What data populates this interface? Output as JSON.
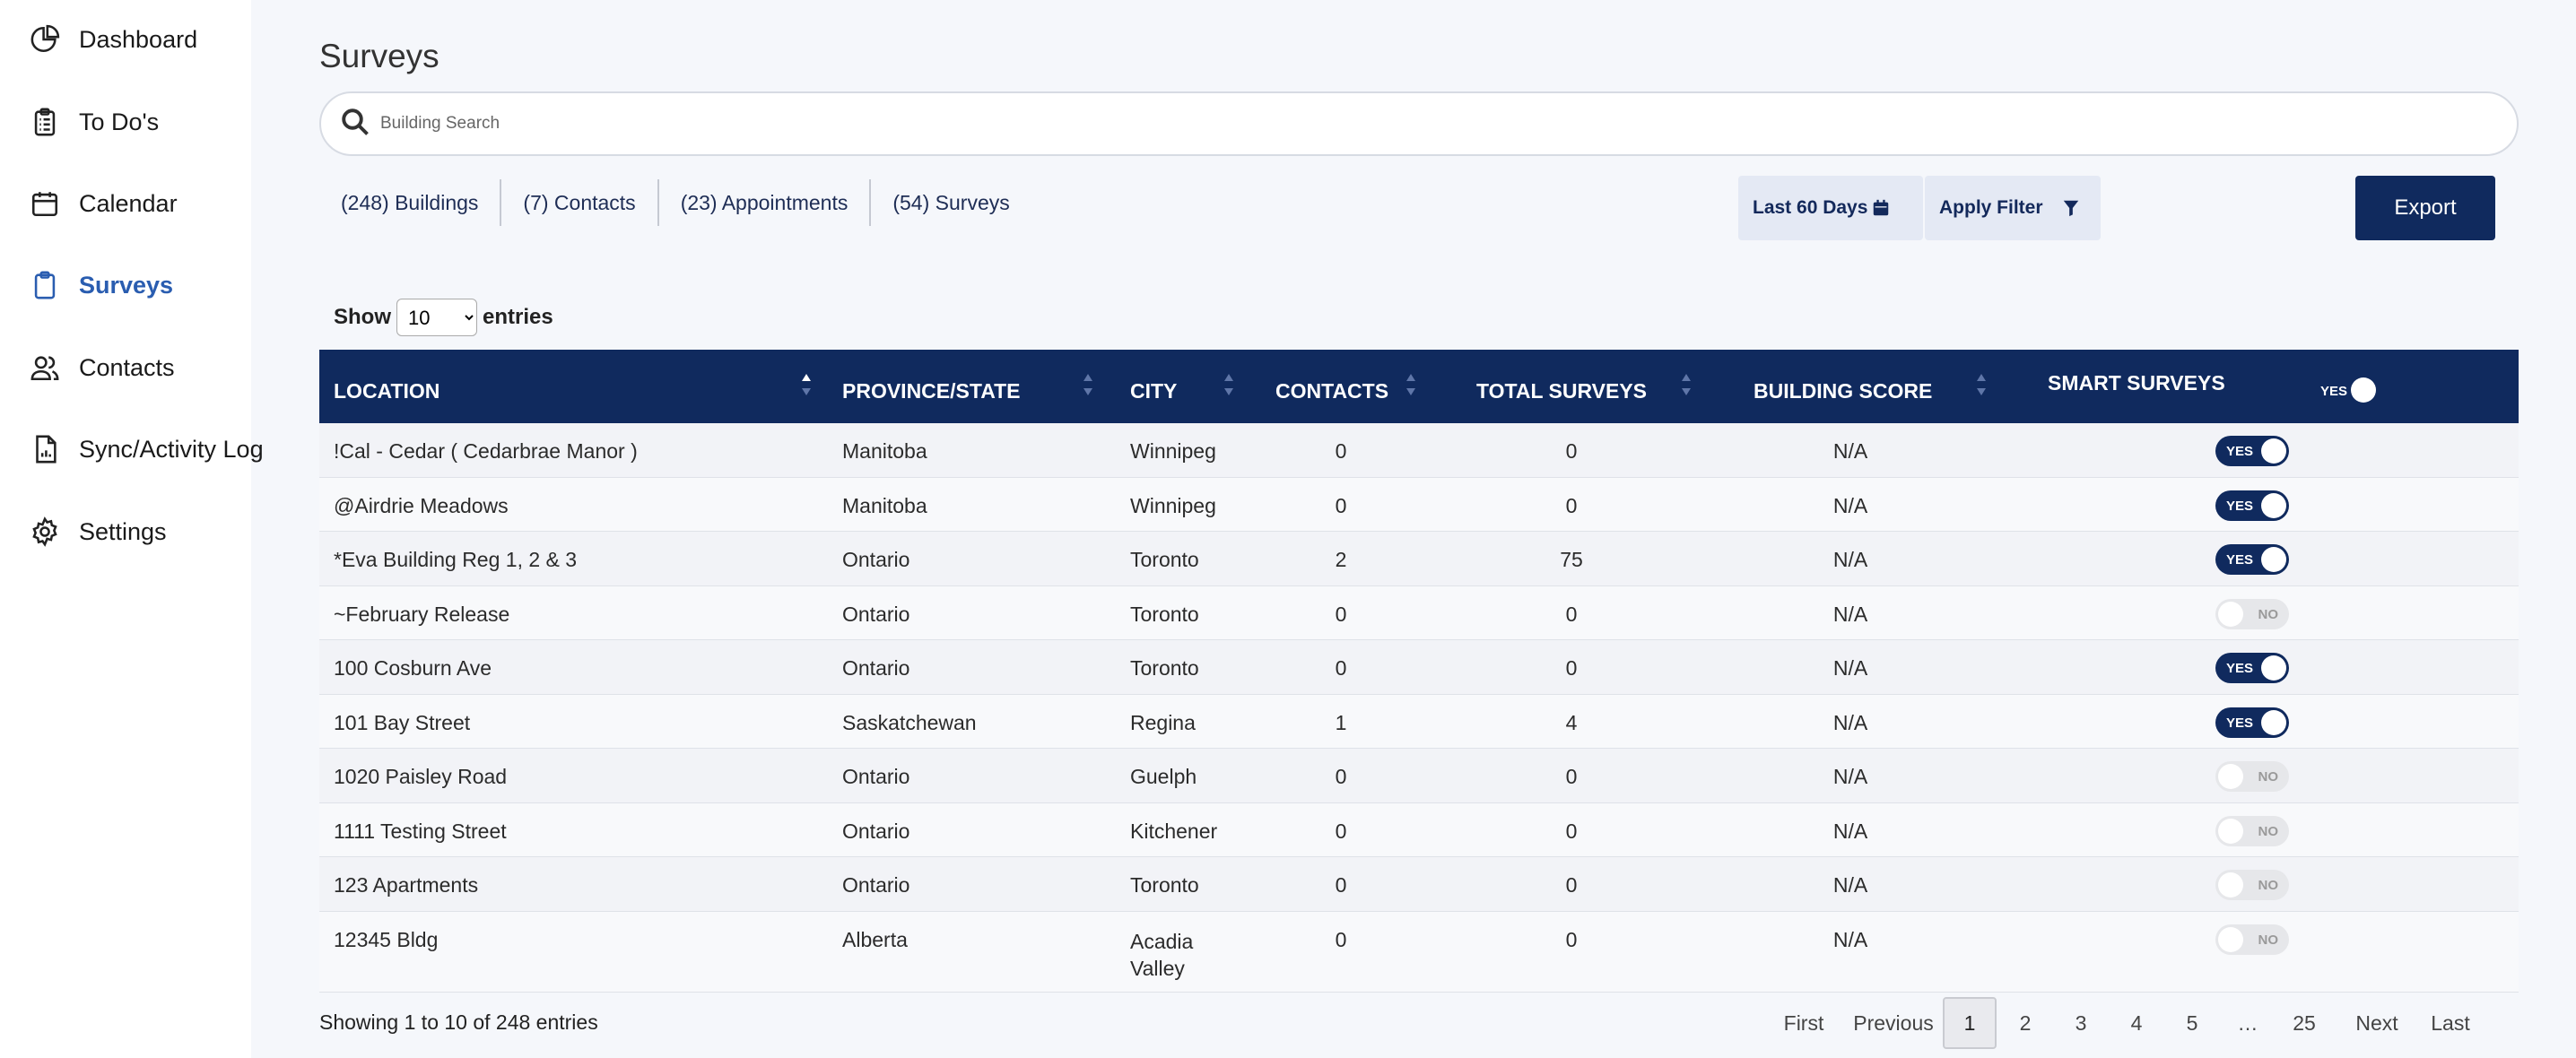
{
  "nav": [
    {
      "label": "Dashboard",
      "icon": "dashboard-pie-icon"
    },
    {
      "label": "To Do's",
      "icon": "clipboard-list-icon"
    },
    {
      "label": "Calendar",
      "icon": "calendar-icon"
    },
    {
      "label": "Surveys",
      "icon": "clipboard-icon"
    },
    {
      "label": "Contacts",
      "icon": "users-icon"
    },
    {
      "label": "Sync/Activity Log",
      "icon": "document-chart-icon"
    },
    {
      "label": "Settings",
      "icon": "gear-icon"
    }
  ],
  "page_title": "Surveys",
  "search": {
    "placeholder": "Building Search",
    "value": ""
  },
  "tabs": [
    "(248) Buildings",
    "(7) Contacts",
    "(23) Appointments",
    "(54) Surveys"
  ],
  "actions": {
    "date_range": "Last 60 Days",
    "apply_filter": "Apply Filter",
    "export": "Export"
  },
  "show_entries": {
    "show": "Show",
    "value": "10",
    "entries": "entries",
    "options": [
      "10"
    ]
  },
  "table": {
    "columns": [
      "LOCATION",
      "PROVINCE/STATE",
      "CITY",
      "CONTACTS",
      "TOTAL SURVEYS",
      "BUILDING SCORE",
      "SMART SURVEYS"
    ],
    "header_toggle_label": "YES",
    "toggle_yes": "YES",
    "toggle_no": "NO",
    "rows": [
      {
        "location": "!Cal - Cedar ( Cedarbrae Manor )",
        "province": "Manitoba",
        "city": "Winnipeg",
        "contacts": "0",
        "surveys": "0",
        "score": "N/A",
        "smart": true
      },
      {
        "location": "@Airdrie Meadows",
        "province": "Manitoba",
        "city": "Winnipeg",
        "contacts": "0",
        "surveys": "0",
        "score": "N/A",
        "smart": true
      },
      {
        "location": "*Eva Building Reg 1, 2 & 3",
        "province": "Ontario",
        "city": "Toronto",
        "contacts": "2",
        "surveys": "75",
        "score": "N/A",
        "smart": true
      },
      {
        "location": "~February Release",
        "province": "Ontario",
        "city": "Toronto",
        "contacts": "0",
        "surveys": "0",
        "score": "N/A",
        "smart": false
      },
      {
        "location": "100 Cosburn Ave",
        "province": "Ontario",
        "city": "Toronto",
        "contacts": "0",
        "surveys": "0",
        "score": "N/A",
        "smart": true
      },
      {
        "location": "101 Bay Street",
        "province": "Saskatchewan",
        "city": "Regina",
        "contacts": "1",
        "surveys": "4",
        "score": "N/A",
        "smart": true
      },
      {
        "location": "1020 Paisley Road",
        "province": "Ontario",
        "city": "Guelph",
        "contacts": "0",
        "surveys": "0",
        "score": "N/A",
        "smart": false
      },
      {
        "location": "1111 Testing Street",
        "province": "Ontario",
        "city": "Kitchener",
        "contacts": "0",
        "surveys": "0",
        "score": "N/A",
        "smart": false
      },
      {
        "location": "123 Apartments",
        "province": "Ontario",
        "city": "Toronto",
        "contacts": "0",
        "surveys": "0",
        "score": "N/A",
        "smart": false
      },
      {
        "location": "12345 Bldg",
        "province": "Alberta",
        "city": "Acadia Valley",
        "contacts": "0",
        "surveys": "0",
        "score": "N/A",
        "smart": false
      }
    ]
  },
  "footer": {
    "info": "Showing 1 to 10 of 248 entries"
  },
  "pagination": {
    "items": [
      "First",
      "Previous",
      "1",
      "2",
      "3",
      "4",
      "5",
      "…",
      "25",
      "Next",
      "Last"
    ],
    "current": "1"
  },
  "colors": {
    "navy": "#102a5e",
    "active_nav": "#2a5db0",
    "filter_bg": "#e4e9f4"
  }
}
